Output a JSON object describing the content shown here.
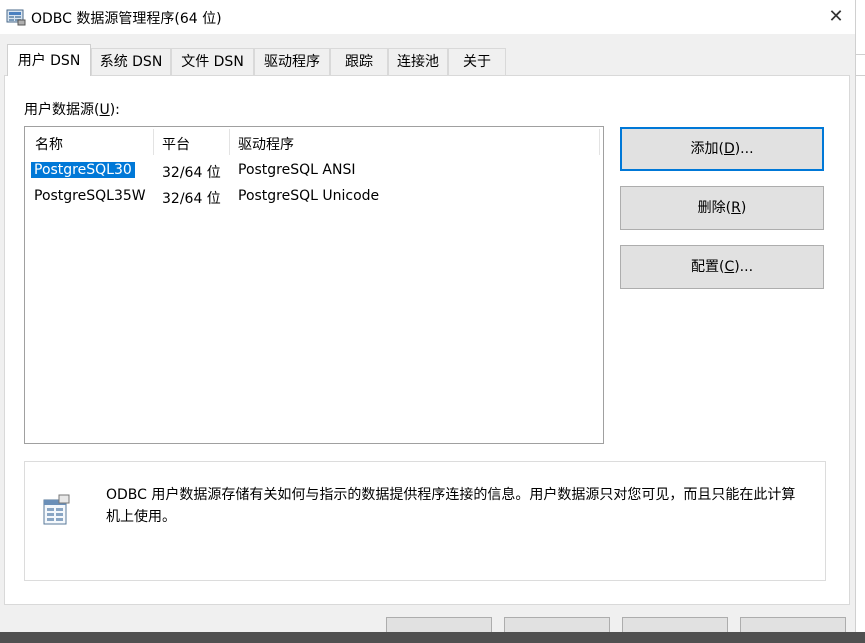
{
  "window": {
    "title": "ODBC 数据源管理程序(64 位)",
    "close_glyph": "✕",
    "app_icon": "odbc-datasource-icon"
  },
  "tabs": [
    {
      "label": "用户 DSN",
      "active": true
    },
    {
      "label": "系统 DSN"
    },
    {
      "label": "文件 DSN"
    },
    {
      "label": "驱动程序"
    },
    {
      "label": "跟踪"
    },
    {
      "label": "连接池"
    },
    {
      "label": "关于"
    }
  ],
  "section_label": {
    "text": "用户数据源(",
    "mnemonic": "U",
    "suffix": "):"
  },
  "list": {
    "columns": [
      "名称",
      "平台",
      "驱动程序"
    ],
    "rows": [
      {
        "name": "PostgreSQL30",
        "platform": "32/64 位",
        "driver": "PostgreSQL ANSI",
        "selected": true
      },
      {
        "name": "PostgreSQL35W",
        "platform": "32/64 位",
        "driver": "PostgreSQL Unicode"
      }
    ]
  },
  "buttons": {
    "add": {
      "text": "添加(",
      "mnemonic": "D",
      "suffix": ")..."
    },
    "remove": {
      "text": "删除(",
      "mnemonic": "R",
      "suffix": ")"
    },
    "configure": {
      "text": "配置(",
      "mnemonic": "C",
      "suffix": ")..."
    }
  },
  "info": {
    "icon": "datasource-table-icon",
    "text": "ODBC 用户数据源存储有关如何与指示的数据提供程序连接的信息。用户数据源只对您可见，而且只能在此计算机上使用。"
  },
  "colors": {
    "selection": "#0078d7",
    "default_button_border": "#0078d7",
    "background": "#f0f0f0"
  }
}
